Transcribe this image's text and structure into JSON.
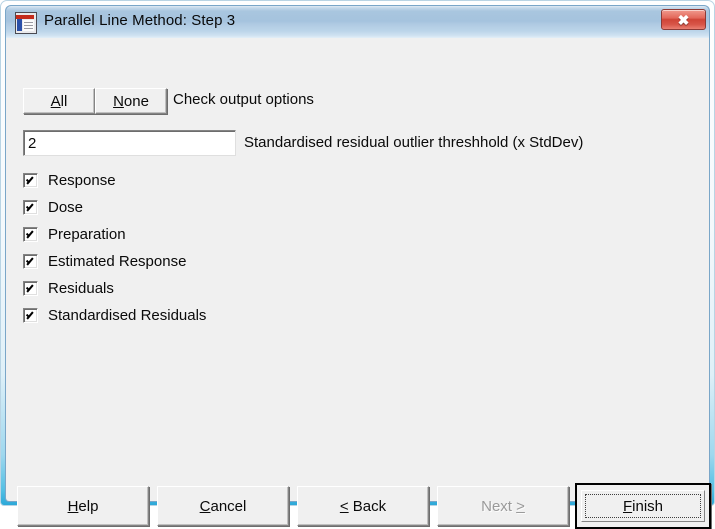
{
  "window": {
    "title": "Parallel Line Method: Step 3",
    "icon": "application-icon",
    "close_label": "✖"
  },
  "toolbar": {
    "all_label": "All",
    "all_accel": "A",
    "none_label": "None",
    "none_accel": "N",
    "instruction": "Check output options"
  },
  "threshold": {
    "value": "2",
    "label": "Standardised residual outlier threshhold (x StdDev)"
  },
  "options": [
    {
      "label": "Response",
      "checked": true
    },
    {
      "label": "Dose",
      "checked": true
    },
    {
      "label": "Preparation",
      "checked": true
    },
    {
      "label": "Estimated Response",
      "checked": true
    },
    {
      "label": "Residuals",
      "checked": true
    },
    {
      "label": "Standardised Residuals",
      "checked": true
    }
  ],
  "buttons": {
    "help": {
      "label": "Help",
      "accel": "H",
      "enabled": true,
      "default": false
    },
    "cancel": {
      "label": "Cancel",
      "accel": "C",
      "enabled": true,
      "default": false
    },
    "back": {
      "label": "< Back",
      "accel": "<",
      "enabled": true,
      "default": false
    },
    "next": {
      "label": "Next >",
      "accel": ">",
      "enabled": false,
      "default": false
    },
    "finish": {
      "label": "Finish",
      "accel": "F",
      "enabled": true,
      "default": true
    }
  },
  "colors": {
    "dialog_face": "#f0f0f0",
    "titlebar_blue": "#a5c3de",
    "close_red": "#cf4436",
    "frame_aero": "#2ca8d8",
    "disabled_text": "#9a9a9a"
  }
}
